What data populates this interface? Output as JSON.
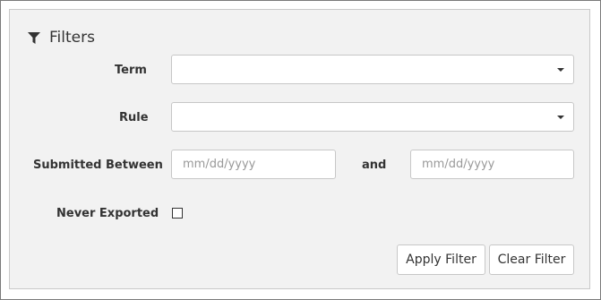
{
  "filters": {
    "title": "Filters",
    "icon": "filter-icon",
    "term": {
      "label": "Term",
      "value": ""
    },
    "rule": {
      "label": "Rule",
      "value": ""
    },
    "submitted_between": {
      "label": "Submitted Between",
      "from_placeholder": "mm/dd/yyyy",
      "and_label": "and",
      "to_placeholder": "mm/dd/yyyy"
    },
    "never_exported": {
      "label": "Never Exported",
      "checked": false
    },
    "buttons": {
      "apply": "Apply Filter",
      "clear": "Clear Filter"
    }
  }
}
